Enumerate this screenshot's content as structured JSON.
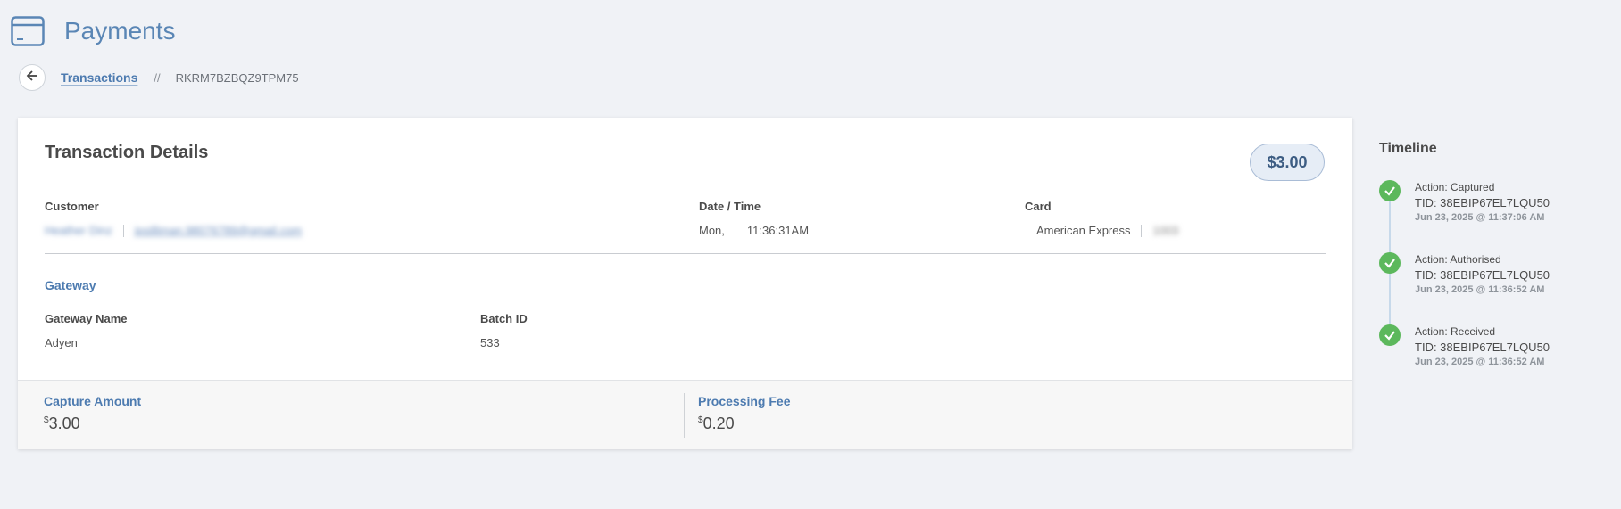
{
  "header": {
    "title": "Payments",
    "icon": "credit-card-icon"
  },
  "breadcrumb": {
    "link": "Transactions",
    "separator": "//",
    "current": "RKRM7BZBQZ9TPM75"
  },
  "details": {
    "title": "Transaction Details",
    "amount": "$3.00",
    "customer": {
      "label": "Customer",
      "name": "Heather Dinz",
      "email": "jpsilliman.98076789@gmail.com"
    },
    "datetime": {
      "label": "Date / Time",
      "day": "Mon,",
      "time": "11:36:31AM"
    },
    "card": {
      "label": "Card",
      "brand": "American Express",
      "last4": "1003"
    },
    "gateway": {
      "section_title": "Gateway",
      "name_label": "Gateway Name",
      "name_value": "Adyen",
      "batch_label": "Batch ID",
      "batch_value": "533"
    },
    "footer": {
      "capture_label": "Capture Amount",
      "capture_currency": "$",
      "capture_value": "3.00",
      "fee_label": "Processing Fee",
      "fee_currency": "$",
      "fee_value": "0.20"
    }
  },
  "timeline": {
    "title": "Timeline",
    "items": [
      {
        "action": "Action: Captured",
        "tid": "TID: 38EBIP67EL7LQU50",
        "date": "Jun 23, 2025 @ 11:37:06 AM"
      },
      {
        "action": "Action: Authorised",
        "tid": "TID: 38EBIP67EL7LQU50",
        "date": "Jun 23, 2025 @ 11:36:52 AM"
      },
      {
        "action": "Action: Received",
        "tid": "TID: 38EBIP67EL7LQU50",
        "date": "Jun 23, 2025 @ 11:36:52 AM"
      }
    ],
    "status_color": "#5cb85c"
  },
  "colors": {
    "accent": "#4d7bb0",
    "background": "#f0f2f6"
  }
}
